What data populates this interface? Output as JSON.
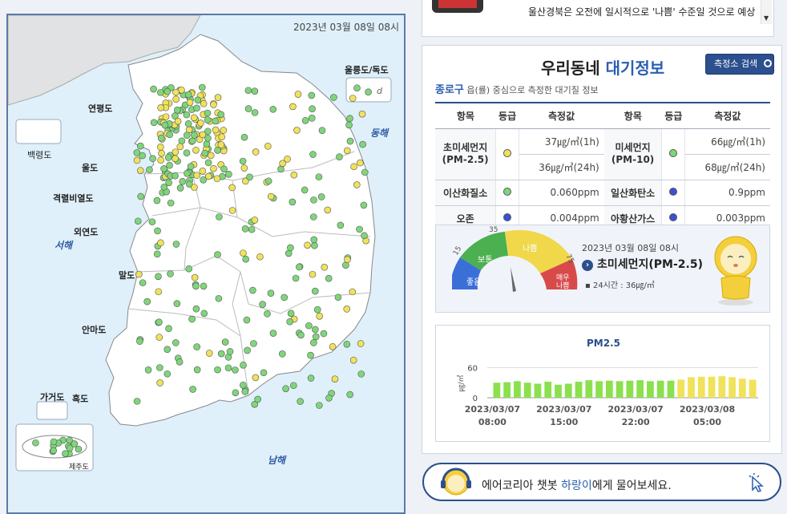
{
  "map": {
    "timestamp": "2023년 03월 08일 08시",
    "regions": {
      "ulleung": "울릉도/독도",
      "dokdo": "d",
      "yeonpyeong": "연평도",
      "baengnyeong": "백령도",
      "uldo": "울도",
      "gyeokryeol": "격렬비열도",
      "oeyeon": "외연도",
      "mal": "말도",
      "anma": "안마도",
      "gageo": "가거도",
      "heuk": "흑도",
      "jeju": "제주도"
    },
    "seas": {
      "east": "동해",
      "west": "서해",
      "south": "남해"
    }
  },
  "news": {
    "text": "울산경북은 오전에 일시적으로 '나쁨' 수준일 것으로 예상"
  },
  "air": {
    "title_main": "우리동네 ",
    "title_accent": "대기정보",
    "search_label": "측정소 검색",
    "district": "종로구",
    "sub_text": " 읍(률) 중심으로 측정한 대기질 정보",
    "headers": [
      "항목",
      "등급",
      "측정값",
      "항목",
      "등급",
      "측정값"
    ],
    "rows": {
      "pm25_label": "초미세먼지\n(PM-2.5)",
      "pm25_1h": "37㎍/㎥(1h)",
      "pm25_24h": "36㎍/㎥(24h)",
      "pm10_label": "미세먼지\n(PM-10)",
      "pm10_1h": "66㎍/㎥(1h)",
      "pm10_24h": "68㎍/㎥(24h)",
      "no2_label": "이산화질소",
      "no2_val": "0.060ppm",
      "co_label": "일산화탄소",
      "co_val": "0.9ppm",
      "o3_label": "오존",
      "o3_val": "0.004ppm",
      "so2_label": "아황산가스",
      "so2_val": "0.003ppm"
    },
    "colors": {
      "good": "#3b4fd8",
      "moderate": "#7fd67a",
      "bad": "#f0e25a",
      "very_bad": "#d84a4a"
    }
  },
  "gauge": {
    "labels": {
      "good": "좋음",
      "moderate": "보통",
      "bad": "나쁨",
      "very_bad": "매우\n나쁨"
    },
    "ticks": [
      "15",
      "35",
      "75"
    ],
    "time": "2023년 03월 08일 08시",
    "item": "초미세먼지(PM-2.5)",
    "avg": "▪ 24시간 : 36㎍/㎥",
    "value": 36
  },
  "chart_data": {
    "type": "bar",
    "title": "PM2.5",
    "ylabel": "㎍/㎥",
    "ylim": [
      0,
      80
    ],
    "yticks": [
      "60",
      "0"
    ],
    "xtick_labels": [
      "2023/03/07\n08:00",
      "2023/03/07\n15:00",
      "2023/03/07\n22:00",
      "2023/03/08\n05:00"
    ],
    "values": [
      30,
      31,
      33,
      30,
      28,
      32,
      26,
      28,
      32,
      35,
      33,
      34,
      33,
      34,
      35,
      33,
      34,
      34,
      36,
      41,
      42,
      42,
      43,
      41,
      38,
      36
    ]
  },
  "chatbot": {
    "before": "에어코리아 챗봇 ",
    "accent": "하랑이",
    "after": "에게 물어보세요."
  }
}
